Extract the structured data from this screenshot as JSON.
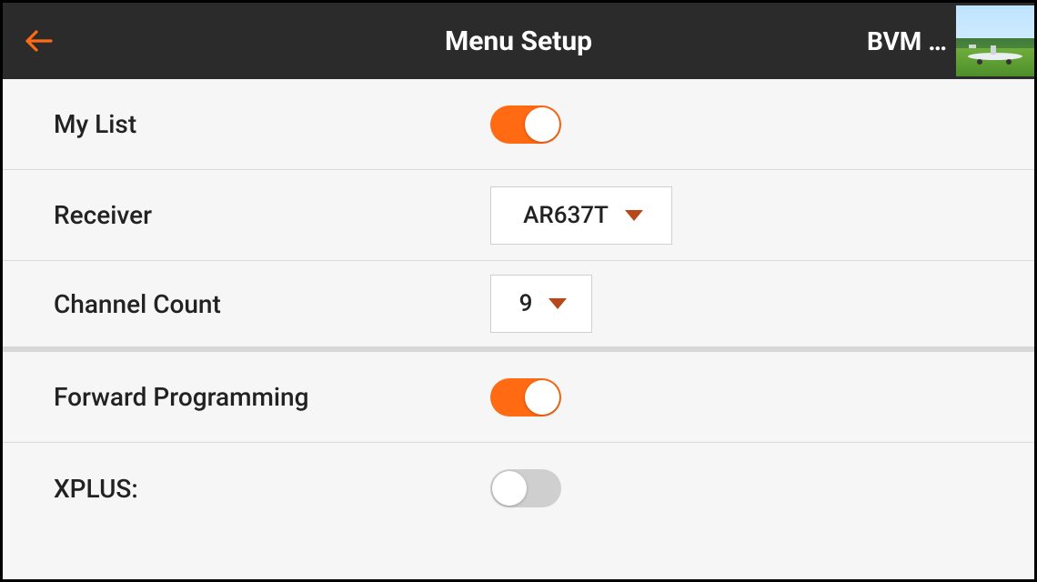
{
  "header": {
    "title": "Menu Setup",
    "model_name": "BVM …"
  },
  "rows": {
    "mylist": {
      "label": "My List",
      "toggle_on": true
    },
    "receiver": {
      "label": "Receiver",
      "value": "AR637T"
    },
    "channels": {
      "label": "Channel Count",
      "value": "9"
    },
    "fwdprog": {
      "label": "Forward Programming",
      "toggle_on": true
    },
    "xplus": {
      "label": "XPLUS:",
      "toggle_on": false
    }
  },
  "colors": {
    "accent": "#ff6a13",
    "caret": "#b6481a",
    "header_bg": "#2b2b2b"
  }
}
